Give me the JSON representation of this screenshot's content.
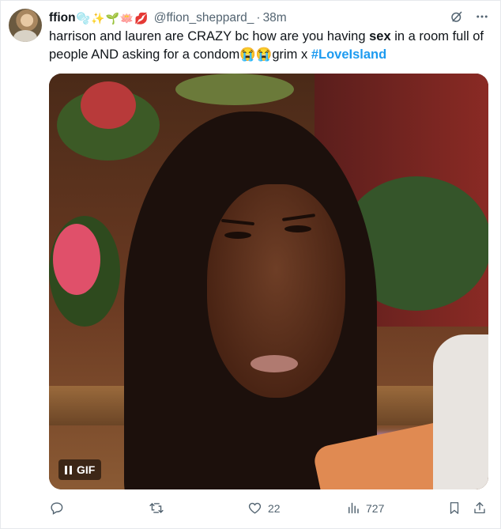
{
  "author": {
    "name": "ffion",
    "name_emojis": "🫧✨🌱🪷💋",
    "handle": "@ffion_sheppard_",
    "separator": "·",
    "time": "38m"
  },
  "tweet": {
    "text_1": "harrison and lauren are CRAZY bc how are you having ",
    "text_bold": "sex",
    "text_2": " in a room full of people AND asking for a condom",
    "text_emojis": "😭😭",
    "text_3": "grim x ",
    "hashtag": "#LoveIsland"
  },
  "media": {
    "badge_label": "GIF",
    "type": "gif"
  },
  "actions": {
    "reply_count": "",
    "retweet_count": "",
    "like_count": "22",
    "views_count": "727"
  },
  "icons": {
    "top": [
      "grok-icon",
      "more-icon"
    ],
    "actions": [
      "reply-icon",
      "retweet-icon",
      "like-icon",
      "views-icon",
      "bookmark-icon",
      "share-icon"
    ]
  },
  "colors": {
    "text": "#0f1419",
    "secondary": "#536471",
    "link": "#1d9bf0"
  }
}
